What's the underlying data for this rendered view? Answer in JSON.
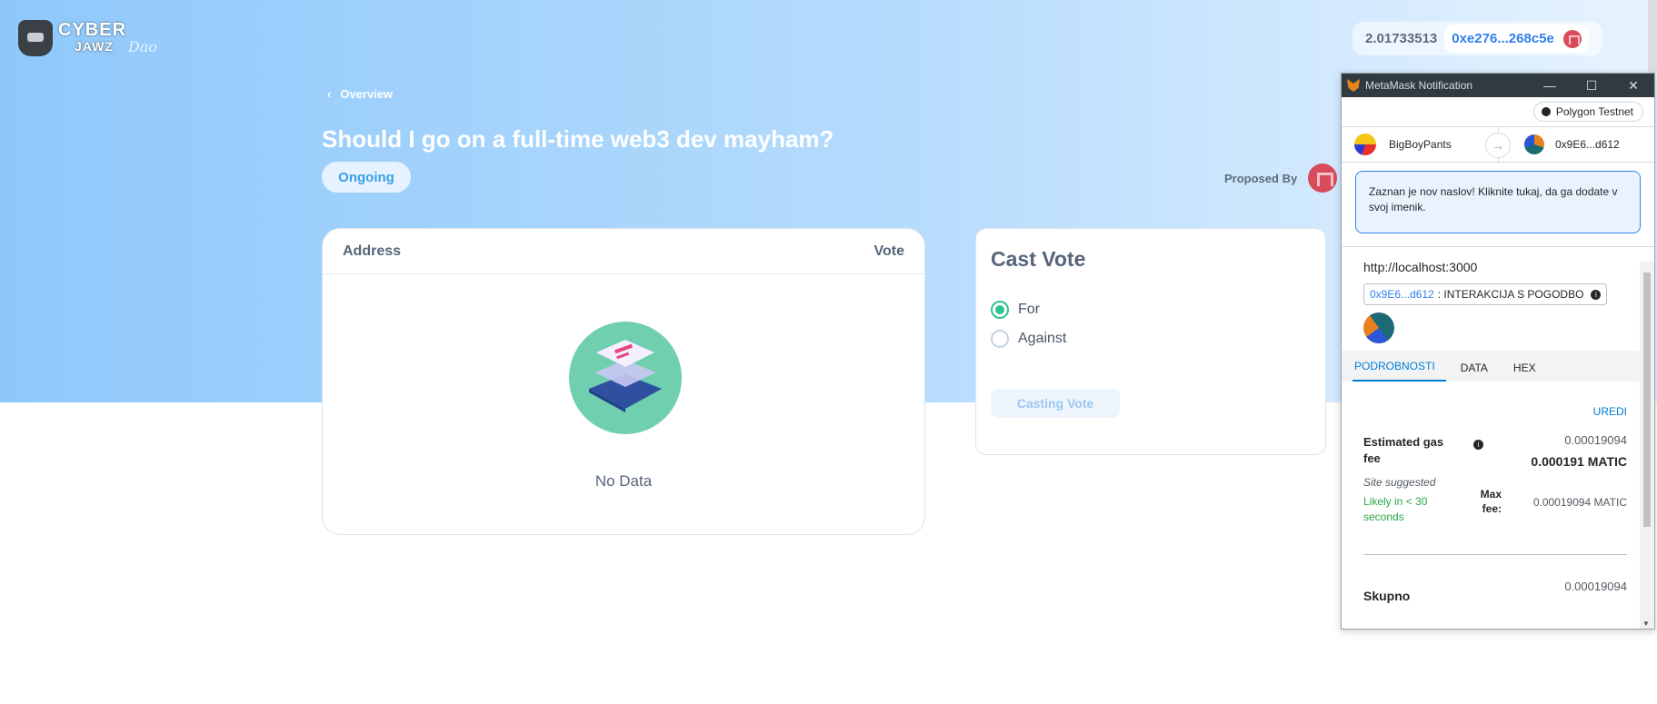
{
  "app": {
    "logo_text_1": "CYBER",
    "logo_text_2": "JAWZ",
    "logo_script": "Dao"
  },
  "wallet": {
    "balance": "2.01733513",
    "address": "0xe276...268c5e"
  },
  "nav": {
    "back_label": "Overview"
  },
  "proposal": {
    "title": "Should I go on a full-time web3 dev mayham?",
    "status": "Ongoing",
    "proposed_by_label": "Proposed By"
  },
  "votes_table": {
    "columns": [
      "Address",
      "Vote"
    ],
    "empty_text": "No Data"
  },
  "cast_vote": {
    "title": "Cast Vote",
    "options": [
      {
        "label": "For",
        "selected": true
      },
      {
        "label": "Against",
        "selected": false
      }
    ],
    "button_label": "Casting Vote"
  },
  "metamask": {
    "window_title": "MetaMask Notification",
    "network": "Polygon Testnet",
    "from_account": "BigBoyPants",
    "to_account": "0x9E6...d612",
    "alert_text": "Zaznan je nov naslov! Kliknite tukaj, da ga dodate v svoj imenik.",
    "origin": "http://localhost:3000",
    "contract_address": "0x9E6...d612",
    "contract_action": ": INTERAKCIJA S POGODBO",
    "tabs": [
      "PODROBNOSTI",
      "DATA",
      "HEX"
    ],
    "active_tab": "PODROBNOSTI",
    "edit_label": "UREDI",
    "gas_label": "Estimated gas fee",
    "gas_fee": "0.00019094",
    "gas_fee_bold": "0.000191 MATIC",
    "site_suggested": "Site suggested",
    "likely": "Likely in < 30 seconds",
    "max_fee_label": "Max fee:",
    "max_fee_value": "0.00019094 MATIC",
    "total_label": "Skupno",
    "total_value": "0.00019094"
  },
  "colors": {
    "accent_blue": "#2f80ed",
    "vote_green": "#2ec48f",
    "metamask_link": "#037dd6"
  }
}
